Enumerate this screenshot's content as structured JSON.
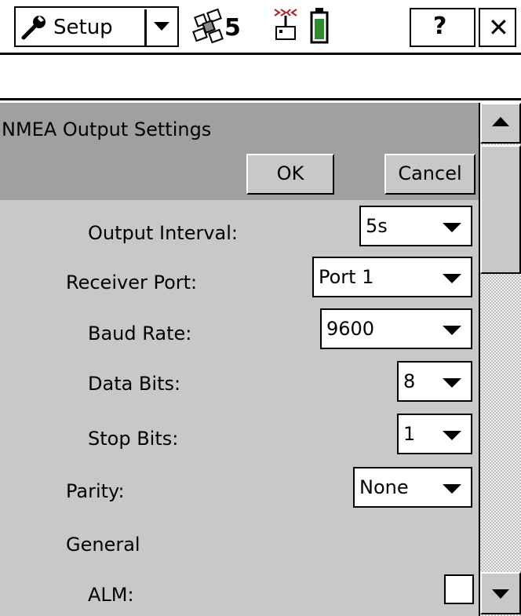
{
  "toolbar": {
    "menu_label": "Setup",
    "menu_icon": "wrench-icon",
    "satellite_icon": "satellite-icon",
    "satellite_count": "5",
    "radio_icon": "radio-antenna-icon",
    "battery_icon": "battery-icon",
    "help_label": "?",
    "close_label": "✕"
  },
  "dialog": {
    "title": "NMEA Output Settings",
    "ok_label": "OK",
    "cancel_label": "Cancel"
  },
  "fields": {
    "output_interval": {
      "label": "Output Interval:",
      "value": "5s"
    },
    "receiver_port": {
      "label": "Receiver Port:",
      "value": "Port 1"
    },
    "baud_rate": {
      "label": "Baud Rate:",
      "value": "9600"
    },
    "data_bits": {
      "label": "Data Bits:",
      "value": "8"
    },
    "stop_bits": {
      "label": "Stop Bits:",
      "value": "1"
    },
    "parity": {
      "label": "Parity:",
      "value": "None"
    },
    "general_heading": "General",
    "alm": {
      "label": "ALM:",
      "checked": false
    }
  },
  "colors": {
    "battery_fill": "#2e8b2e",
    "antenna_signal": "#b22222",
    "panel_gray": "#c8c8c8",
    "header_gray": "#a0a0a0"
  }
}
